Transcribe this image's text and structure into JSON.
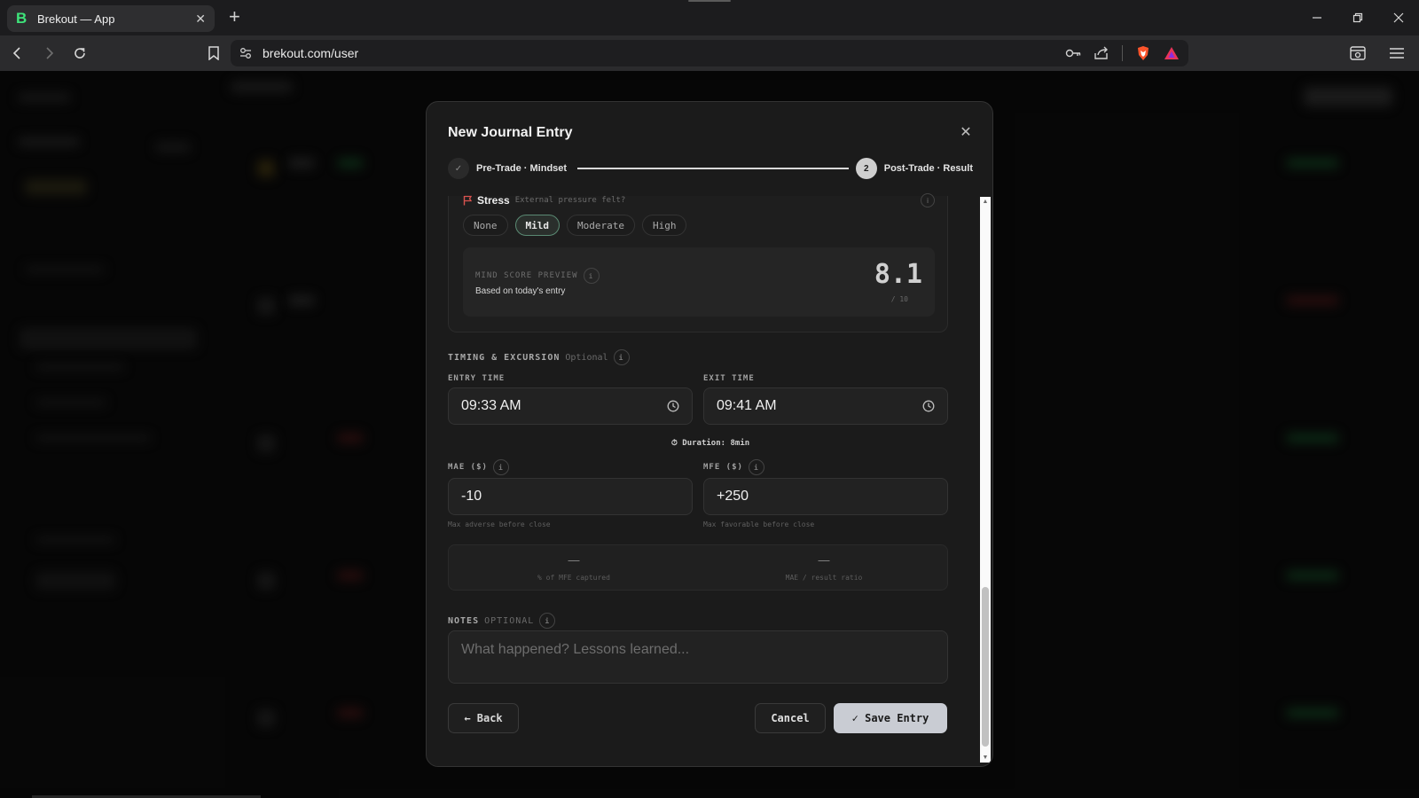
{
  "browser": {
    "tab_title": "Brekout — App",
    "tab_favicon": "B",
    "url": "brekout.com/user"
  },
  "modal": {
    "title": "New Journal Entry",
    "steps": [
      {
        "number": "✓",
        "label": "Pre-Trade · Mindset",
        "state": "done"
      },
      {
        "number": "2",
        "label": "Post-Trade · Result",
        "state": "active"
      }
    ],
    "stress": {
      "title": "Stress",
      "subtitle": "External pressure felt?",
      "options": [
        "None",
        "Mild",
        "Moderate",
        "High"
      ],
      "selected": "Mild"
    },
    "mind_score": {
      "label": "MIND SCORE PREVIEW",
      "subtitle": "Based on today's entry",
      "value": "8.1",
      "out_of": "/ 10"
    },
    "timing": {
      "section_title": "TIMING & EXCURSION",
      "optional": "Optional",
      "entry_label": "ENTRY TIME",
      "entry_value": "09:33 AM",
      "exit_label": "EXIT TIME",
      "exit_value": "09:41 AM",
      "duration": "Duration: 8min"
    },
    "excursion": {
      "mae_label": "MAE ($)",
      "mae_value": "-10",
      "mae_helper": "Max adverse before close",
      "mfe_label": "MFE ($)",
      "mfe_value": "+250",
      "mfe_helper": "Max favorable before close",
      "captured_value": "—",
      "captured_label": "% of MFE captured",
      "ratio_value": "—",
      "ratio_label": "MAE / result ratio"
    },
    "notes": {
      "label": "NOTES",
      "optional": "OPTIONAL",
      "placeholder": "What happened? Lessons learned..."
    },
    "buttons": {
      "back": "← Back",
      "cancel": "Cancel",
      "save": "✓ Save Entry"
    }
  },
  "colors": {
    "accent_green": "#3ee37a",
    "stress_flag": "#d9534f",
    "save_button": "#c9ccd3"
  }
}
